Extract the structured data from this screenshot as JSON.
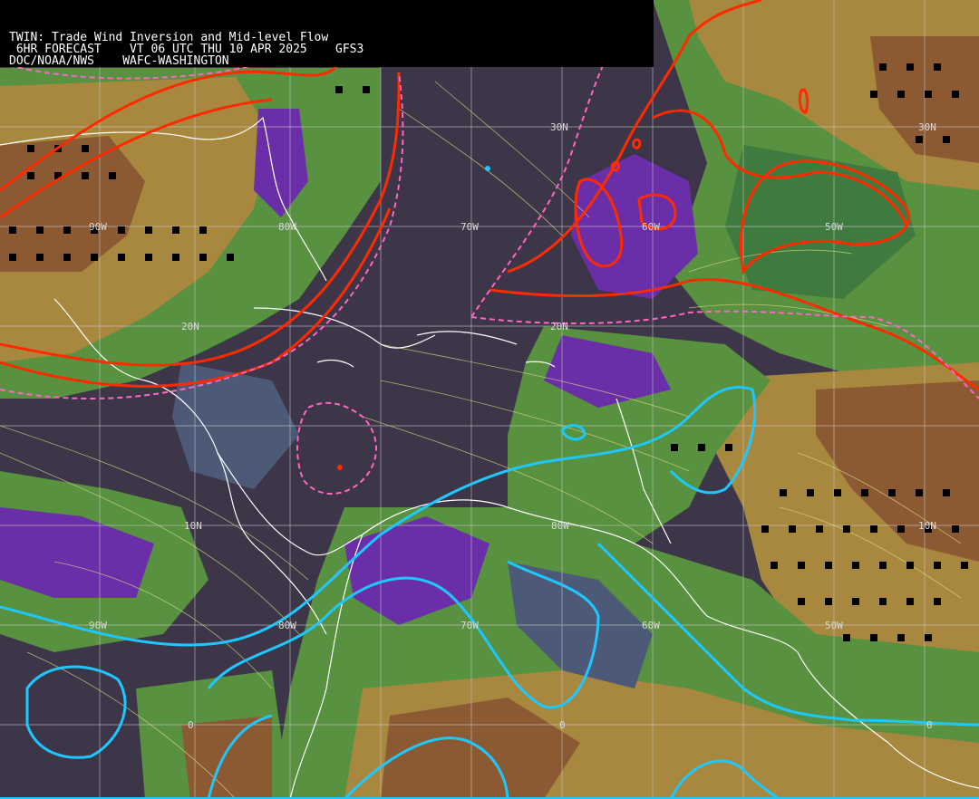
{
  "header": {
    "line1": "TWIN: Trade Wind Inversion and Mid-level Flow",
    "line2": " 6HR FORECAST    VT 06 UTC THU 10 APR 2025    GFS3",
    "line3": "DOC/NOAA/NWS    WAFC-WASHINGTON"
  },
  "grid_labels": {
    "lat": [
      "30N",
      "30N",
      "20N",
      "20N",
      "10N",
      "10N",
      "0",
      "0",
      "0"
    ],
    "lon": [
      "90W",
      "80W",
      "70W",
      "60W",
      "50W",
      "90W",
      "80W",
      "70W",
      "60W",
      "50W",
      "80W"
    ]
  },
  "colors": {
    "background": "#3d3548",
    "purple_band": "#6a2fa8",
    "slate_band": "#4c5a78",
    "green_low": "#3f7a3e",
    "green_mid": "#58913f",
    "olive": "#8a8b3a",
    "tan": "#a8883e",
    "brown": "#8b5a33",
    "red_contour": "#ff2a00",
    "pink_dashed": "#ff66c4",
    "cyan_contour": "#1ec8ff",
    "grid": "#c8c8c8",
    "coastline": "#ffffff",
    "streamline": "#d8d78a"
  }
}
